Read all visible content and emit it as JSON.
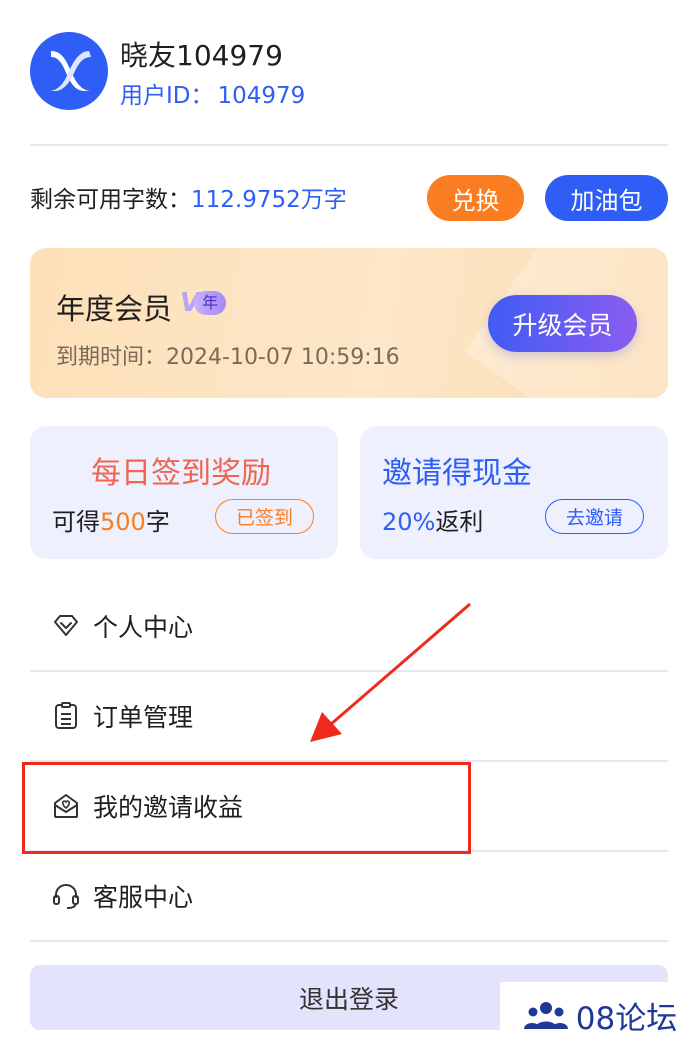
{
  "user": {
    "name": "晓友104979",
    "id_label": "用户ID：",
    "id_value": "104979",
    "avatar_icon": "x-logo-icon"
  },
  "quota": {
    "label": "剩余可用字数：",
    "value": "112.9752万字",
    "exchange_label": "兑换",
    "pack_label": "加油包"
  },
  "membership": {
    "title": "年度会员",
    "badge_v": "V",
    "badge_year": "年",
    "expire_label": "到期时间：",
    "expire_value": "2024-10-07 10:59:16",
    "upgrade_label": "升级会员"
  },
  "checkin": {
    "title": "每日签到奖励",
    "sub_prefix": "可得",
    "sub_num": "500",
    "sub_suffix": "字",
    "button_label": "已签到"
  },
  "invite": {
    "title": "邀请得现金",
    "sub_num": "20%",
    "sub_suffix": "返利",
    "button_label": "去邀请"
  },
  "menu": {
    "items": [
      {
        "label": "个人中心",
        "icon": "diamond-icon"
      },
      {
        "label": "订单管理",
        "icon": "order-list-icon"
      },
      {
        "label": "我的邀请收益",
        "icon": "invite-envelope-icon"
      },
      {
        "label": "客服中心",
        "icon": "headset-icon"
      }
    ]
  },
  "logout_label": "退出登录",
  "watermark": {
    "text": "08论坛",
    "icon": "people-group-icon"
  },
  "colors": {
    "brand_blue": "#2f5ef6",
    "orange": "#fb7d22",
    "highlight_red": "#ee2a1c"
  }
}
